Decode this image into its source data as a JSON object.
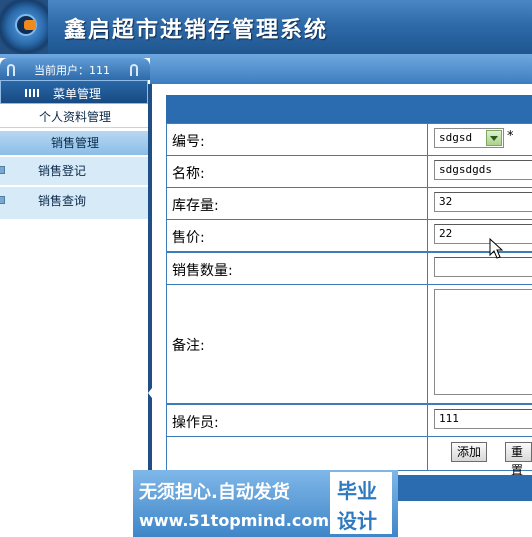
{
  "header": {
    "title": "鑫启超市进销存管理系统"
  },
  "sidebar": {
    "current_user": "当前用户：111",
    "menu_title": "菜单管理",
    "profile_item": "个人资料管理",
    "sales_header": "销售管理",
    "items": [
      {
        "label": "销售登记"
      },
      {
        "label": "销售查询"
      }
    ]
  },
  "form": {
    "fields": [
      {
        "label": "编号:",
        "value": "sdgsd",
        "required_mark": "*"
      },
      {
        "label": "名称:",
        "value": "sdgsdgds"
      },
      {
        "label": "库存量:",
        "value": "32"
      },
      {
        "label": "售价:",
        "value": "22"
      },
      {
        "label": "销售数量:",
        "value": ""
      },
      {
        "label": "备注:",
        "value": ""
      },
      {
        "label": "操作员:",
        "value": "111"
      }
    ],
    "buttons": {
      "add": "添加",
      "reset": "重置"
    }
  },
  "watermark": {
    "slogan": "无须担心.自动发货",
    "url": "www.51topmind.com",
    "box_line1": "毕业",
    "box_line2": "设计"
  }
}
